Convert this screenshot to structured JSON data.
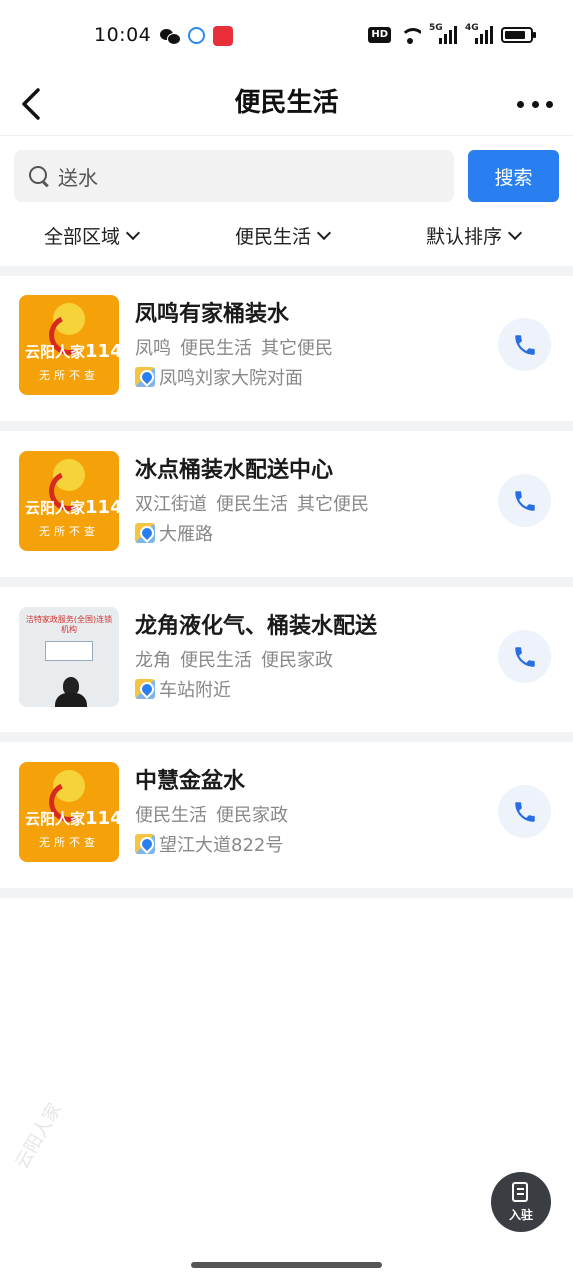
{
  "status_bar": {
    "time": "10:04",
    "hd_label": "HD",
    "net1": "5G",
    "net2": "4G"
  },
  "nav": {
    "title": "便民生活",
    "back_icon": "chevron-left-icon",
    "more_icon": "more-dots-icon"
  },
  "search": {
    "value": "送水",
    "button_label": "搜索"
  },
  "filters": [
    {
      "label": "全部区域"
    },
    {
      "label": "便民生活"
    },
    {
      "label": "默认排序"
    }
  ],
  "listings": [
    {
      "title": "凤鸣有家桶装水",
      "tags": [
        "凤鸣",
        "便民生活",
        "其它便民"
      ],
      "address": "凤鸣刘家大院对面",
      "thumb_brand": "云阳人家",
      "thumb_number": "114",
      "thumb_slogan": "无所不查"
    },
    {
      "title": "冰点桶装水配送中心",
      "tags": [
        "双江街道",
        "便民生活",
        "其它便民"
      ],
      "address": "大雁路",
      "thumb_brand": "云阳人家",
      "thumb_number": "114",
      "thumb_slogan": "无所不查"
    },
    {
      "title": "龙角液化气、桶装水配送",
      "tags": [
        "龙角",
        "便民生活",
        "便民家政"
      ],
      "address": "车站附近",
      "thumb_banner": "洁特家政服务(全国)连锁机构"
    },
    {
      "title": "中慧金盆水",
      "tags": [
        "便民生活",
        "便民家政"
      ],
      "address": "望江大道822号",
      "thumb_brand": "云阳人家",
      "thumb_number": "114",
      "thumb_slogan": "无所不查"
    }
  ],
  "join_button": {
    "label": "入驻"
  },
  "watermark": "云阳人家",
  "colors": {
    "accent": "#2a7ff0",
    "brand_orange": "#f5a10a",
    "brand_red": "#d52a1e"
  }
}
